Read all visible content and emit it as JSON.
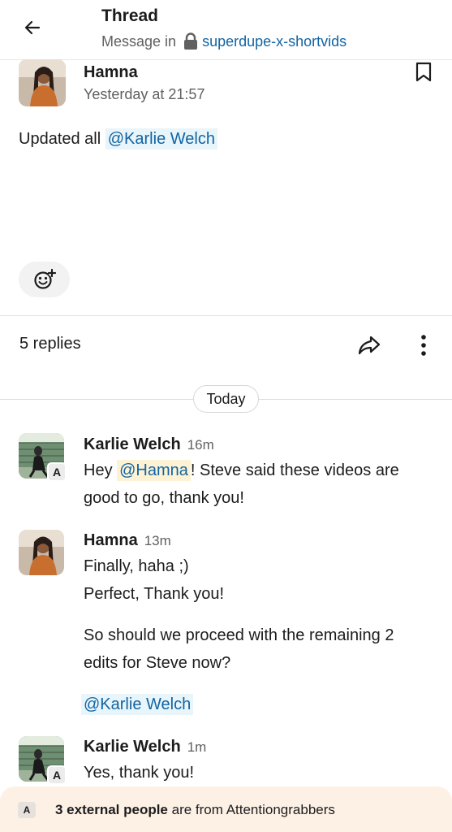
{
  "header": {
    "title": "Thread",
    "subtitle_prefix": "Message in",
    "channel": "superdupe-x-shortvids",
    "back_icon": "arrow-left-icon",
    "lock_icon": "lock-icon"
  },
  "parent_message": {
    "author": "Hamna",
    "timestamp": "Yesterday at 21:57",
    "text_prefix": "Updated all ",
    "mention": "@Karlie Welch",
    "bookmark_icon": "bookmark-icon",
    "add_reaction_icon": "add-reaction-icon"
  },
  "thread_bar": {
    "replies": "5 replies",
    "share_icon": "share-icon",
    "more_icon": "more-vertical-icon"
  },
  "day_separator": "Today",
  "replies": [
    {
      "author": "Karlie Welch",
      "time": "16m",
      "external_badge": "A",
      "line1_prefix": "Hey ",
      "line1_mention": "@Hamna",
      "line1_suffix": "! Steve said these videos are",
      "line2": "good to go, thank you!"
    },
    {
      "author": "Hamna",
      "time": "13m",
      "line1": "Finally, haha ;)",
      "line2": "Perfect, Thank you!",
      "line3": "So should we proceed with the remaining 2",
      "line4": "edits for Steve now?",
      "mention": "@Karlie Welch"
    },
    {
      "author": "Karlie Welch",
      "time": "1m",
      "external_badge": "A",
      "line1": "Yes, thank you!"
    }
  ],
  "banner": {
    "badge": "A",
    "bold": "3 external people",
    "rest": " are from Attentiongrabbers"
  },
  "colors": {
    "link": "#1264a3",
    "mention_bg": "#e8f5fa",
    "self_mention_bg": "#fdf3d4",
    "banner_bg": "#fdf1e6"
  }
}
